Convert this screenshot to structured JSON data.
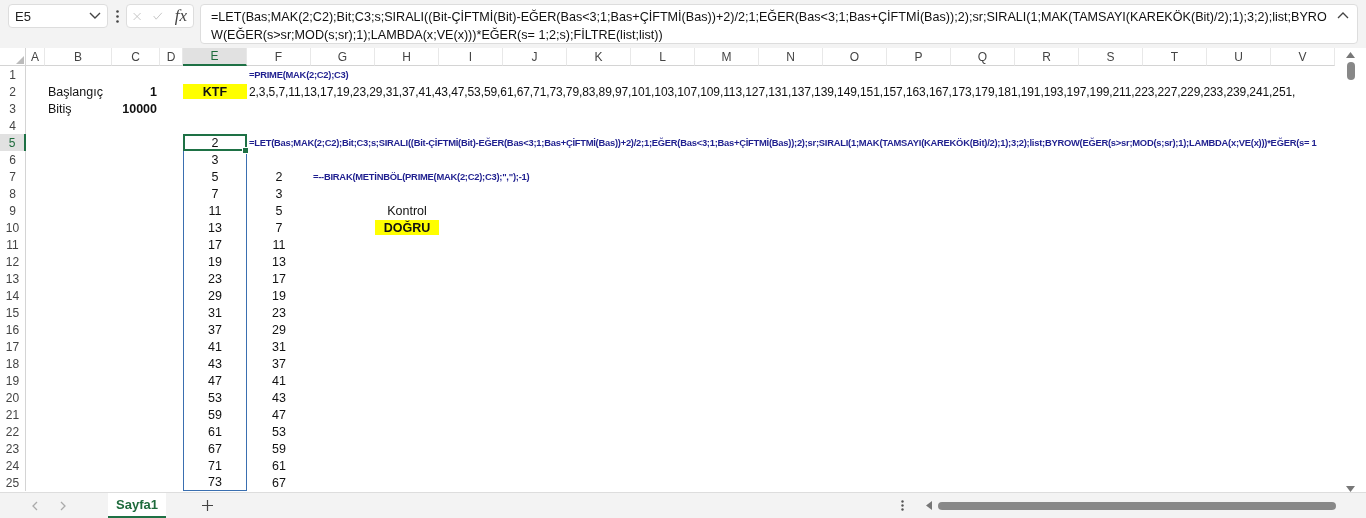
{
  "formula_bar": {
    "name_box": "E5",
    "function_button": "fx",
    "formula": "=LET(Bas;MAK(2;C2);Bit;C3;s;SIRALI((Bit-ÇİFTMİ(Bit)-EĞER(Bas<3;1;Bas+ÇİFTMİ(Bas))+2)/2;1;EĞER(Bas<3;1;Bas+ÇİFTMİ(Bas));2);sr;SIRALI(1;MAK(TAMSAYI(KAREKÖK(Bit)/2);1);3;2);list;BYROW(EĞER(s>sr;MOD(s;sr);1);LAMBDA(x;VE(x)))*EĞER(s= 1;2;s);FİLTRE(list;list))"
  },
  "sheet": {
    "columns": [
      {
        "label": "A",
        "selected": false
      },
      {
        "label": "B",
        "selected": false
      },
      {
        "label": "C",
        "selected": false
      },
      {
        "label": "D",
        "selected": false
      },
      {
        "label": "E",
        "selected": true
      },
      {
        "label": "F",
        "selected": false
      },
      {
        "label": "G",
        "selected": false
      },
      {
        "label": "H",
        "selected": false
      },
      {
        "label": "I",
        "selected": false
      },
      {
        "label": "J",
        "selected": false
      },
      {
        "label": "K",
        "selected": false
      },
      {
        "label": "L",
        "selected": false
      },
      {
        "label": "M",
        "selected": false
      },
      {
        "label": "N",
        "selected": false
      },
      {
        "label": "O",
        "selected": false
      },
      {
        "label": "P",
        "selected": false
      },
      {
        "label": "Q",
        "selected": false
      },
      {
        "label": "R",
        "selected": false
      },
      {
        "label": "S",
        "selected": false
      },
      {
        "label": "T",
        "selected": false
      },
      {
        "label": "U",
        "selected": false
      },
      {
        "label": "V",
        "selected": false
      }
    ],
    "rows": [
      {
        "label": "1",
        "selected": false,
        "cells": [
          "",
          "",
          "",
          "",
          "",
          {
            "kind": "formula",
            "text": "=PRIME(MAK(2;C2);C3)"
          }
        ]
      },
      {
        "label": "2",
        "selected": false,
        "cells": [
          "",
          {
            "kind": "label",
            "text": "Başlangıç"
          },
          {
            "kind": "number",
            "text": "1"
          },
          "",
          {
            "kind": "result",
            "text": "KTF"
          },
          {
            "kind": "list",
            "text": "2,3,5,7,11,13,17,19,23,29,31,37,41,43,47,53,59,61,67,71,73,79,83,89,97,101,103,107,109,113,127,131,137,139,149,151,157,163,167,173,179,181,191,193,197,199,211,223,227,229,233,239,241,251,"
          }
        ]
      },
      {
        "label": "3",
        "selected": false,
        "cells": [
          "",
          {
            "kind": "label",
            "text": "Bitiş"
          },
          {
            "kind": "number",
            "text": "10000"
          }
        ]
      },
      {
        "label": "4",
        "selected": false,
        "cells": []
      },
      {
        "label": "5",
        "selected": true,
        "cells": [
          "",
          "",
          "",
          "",
          {
            "kind": "spill",
            "text": "2"
          },
          {
            "kind": "formula",
            "text": "=LET(Bas;MAK(2;C2);Bit;C3;s;SIRALI((Bit-ÇİFTMİ(Bit)-EĞER(Bas<3;1;Bas+ÇİFTMİ(Bas))+2)/2;1;EĞER(Bas<3;1;Bas+ÇİFTMİ(Bas));2);sr;SIRALI(1;MAK(TAMSAYI(KAREKÖK(Bit)/2);1);3;2);list;BYROW(EĞER(s>sr;MOD(s;sr);1);LAMBDA(x;VE(x)))*EĞER(s= 1"
          }
        ]
      },
      {
        "label": "6",
        "selected": false,
        "cells": [
          "",
          "",
          "",
          "",
          {
            "kind": "spill",
            "text": "3"
          }
        ]
      },
      {
        "label": "7",
        "selected": false,
        "cells": [
          "",
          "",
          "",
          "",
          {
            "kind": "spill",
            "text": "5"
          },
          {
            "kind": "value",
            "text": "2"
          },
          {
            "kind": "formula",
            "text": "=--BIRAK(METİNBÖL(PRIME(MAK(2;C2);C3);\",\");-1)"
          }
        ]
      },
      {
        "label": "8",
        "selected": false,
        "cells": [
          "",
          "",
          "",
          "",
          {
            "kind": "spill",
            "text": "7"
          },
          {
            "kind": "value",
            "text": "3"
          }
        ]
      },
      {
        "label": "9",
        "selected": false,
        "cells": [
          "",
          "",
          "",
          "",
          {
            "kind": "spill",
            "text": "11"
          },
          {
            "kind": "value",
            "text": "5"
          },
          "",
          {
            "kind": "value",
            "text": "Kontrol"
          }
        ]
      },
      {
        "label": "10",
        "selected": false,
        "cells": [
          "",
          "",
          "",
          "",
          {
            "kind": "spill",
            "text": "13"
          },
          {
            "kind": "value",
            "text": "7"
          },
          "",
          {
            "kind": "result",
            "text": "DOĞRU"
          }
        ]
      },
      {
        "label": "11",
        "selected": false,
        "cells": [
          "",
          "",
          "",
          "",
          {
            "kind": "spill",
            "text": "17"
          },
          {
            "kind": "value",
            "text": "11"
          }
        ]
      },
      {
        "label": "12",
        "selected": false,
        "cells": [
          "",
          "",
          "",
          "",
          {
            "kind": "spill",
            "text": "19"
          },
          {
            "kind": "value",
            "text": "13"
          }
        ]
      },
      {
        "label": "13",
        "selected": false,
        "cells": [
          "",
          "",
          "",
          "",
          {
            "kind": "spill",
            "text": "23"
          },
          {
            "kind": "value",
            "text": "17"
          }
        ]
      },
      {
        "label": "14",
        "selected": false,
        "cells": [
          "",
          "",
          "",
          "",
          {
            "kind": "spill",
            "text": "29"
          },
          {
            "kind": "value",
            "text": "19"
          }
        ]
      },
      {
        "label": "15",
        "selected": false,
        "cells": [
          "",
          "",
          "",
          "",
          {
            "kind": "spill",
            "text": "31"
          },
          {
            "kind": "value",
            "text": "23"
          }
        ]
      },
      {
        "label": "16",
        "selected": false,
        "cells": [
          "",
          "",
          "",
          "",
          {
            "kind": "spill",
            "text": "37"
          },
          {
            "kind": "value",
            "text": "29"
          }
        ]
      },
      {
        "label": "17",
        "selected": false,
        "cells": [
          "",
          "",
          "",
          "",
          {
            "kind": "spill",
            "text": "41"
          },
          {
            "kind": "value",
            "text": "31"
          }
        ]
      },
      {
        "label": "18",
        "selected": false,
        "cells": [
          "",
          "",
          "",
          "",
          {
            "kind": "spill",
            "text": "43"
          },
          {
            "kind": "value",
            "text": "37"
          }
        ]
      },
      {
        "label": "19",
        "selected": false,
        "cells": [
          "",
          "",
          "",
          "",
          {
            "kind": "spill",
            "text": "47"
          },
          {
            "kind": "value",
            "text": "41"
          }
        ]
      },
      {
        "label": "20",
        "selected": false,
        "cells": [
          "",
          "",
          "",
          "",
          {
            "kind": "spill",
            "text": "53"
          },
          {
            "kind": "value",
            "text": "43"
          }
        ]
      },
      {
        "label": "21",
        "selected": false,
        "cells": [
          "",
          "",
          "",
          "",
          {
            "kind": "spill",
            "text": "59"
          },
          {
            "kind": "value",
            "text": "47"
          }
        ]
      },
      {
        "label": "22",
        "selected": false,
        "cells": [
          "",
          "",
          "",
          "",
          {
            "kind": "spill",
            "text": "61"
          },
          {
            "kind": "value",
            "text": "53"
          }
        ]
      },
      {
        "label": "23",
        "selected": false,
        "cells": [
          "",
          "",
          "",
          "",
          {
            "kind": "spill",
            "text": "67"
          },
          {
            "kind": "value",
            "text": "59"
          }
        ]
      },
      {
        "label": "24",
        "selected": false,
        "cells": [
          "",
          "",
          "",
          "",
          {
            "kind": "spill",
            "text": "71"
          },
          {
            "kind": "value",
            "text": "61"
          }
        ]
      },
      {
        "label": "25",
        "selected": false,
        "cells": [
          "",
          "",
          "",
          "",
          {
            "kind": "spill",
            "text": "73"
          },
          {
            "kind": "value",
            "text": "67"
          }
        ]
      }
    ]
  },
  "sheet_tabs": [
    {
      "label": "Sayfa1",
      "selected": true
    }
  ]
}
